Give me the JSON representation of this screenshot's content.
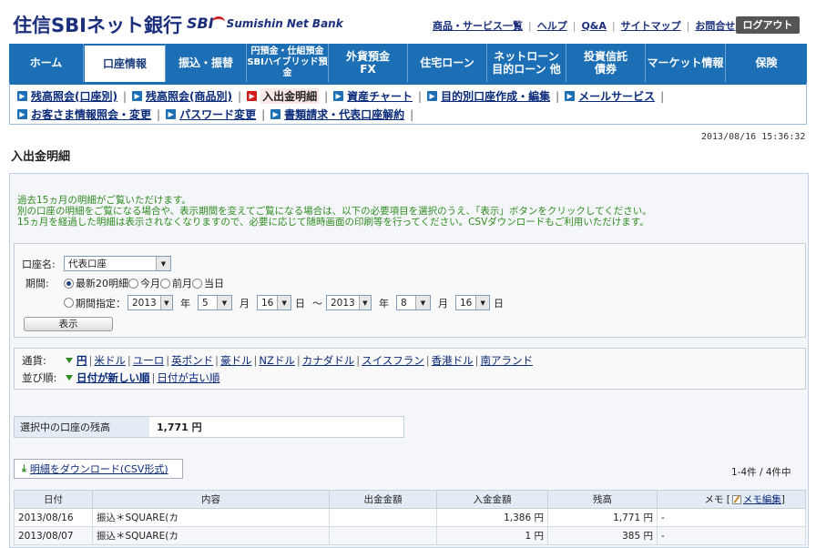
{
  "header": {
    "logo_jp": "住信SBIネット銀行",
    "logo_sbi": "SBI",
    "logo_sumishin": "Sumishin",
    "logo_netbank": "Net Bank",
    "top_links": [
      "商品・サービス一覧",
      "ヘルプ",
      "Q&A",
      "サイトマップ",
      "お問合せ"
    ],
    "logout_label": "ログアウト"
  },
  "nav": {
    "items": [
      {
        "label": "ホーム"
      },
      {
        "label": "口座情報"
      },
      {
        "label": "振込・振替"
      },
      {
        "label": "円預金・仕組預金\nSBIハイブリッド預金"
      },
      {
        "label": "外貨預金\nFX"
      },
      {
        "label": "住宅ローン"
      },
      {
        "label": "ネットローン\n目的ローン 他"
      },
      {
        "label": "投資信託\n債券"
      },
      {
        "label": "マーケット情報"
      },
      {
        "label": "保険"
      }
    ]
  },
  "subnav": {
    "row1": [
      "残高照会(口座別)",
      "残高照会(商品別)",
      "入出金明細",
      "資産チャート",
      "目的別口座作成・編集",
      "メールサービス"
    ],
    "row2": [
      "お客さま情報照会・変更",
      "パスワード変更",
      "書類請求・代表口座解約"
    ],
    "arrow": "▶"
  },
  "timestamp": "2013/08/16 15:36:32",
  "page_title": "入出金明細",
  "notice": {
    "line1": "過去15ヵ月の明細がご覧いただけます。",
    "line2": "別の口座の明細をご覧になる場合や、表示期間を変えてご覧になる場合は、以下の必要項目を選択のうえ、「表示」ボタンをクリックしてください。",
    "line3": "15ヵ月を経過した明細は表示されなくなりますので、必要に応じて随時画面の印刷等を行ってください。CSVダウンロードもご利用いただけます。"
  },
  "form": {
    "account_label": "口座名:",
    "account_value": "代表口座",
    "period_label": "期間:",
    "period_options": [
      "最新20明細",
      "今月",
      "前月",
      "当日"
    ],
    "period_specify": "期間指定：",
    "from_year": "2013",
    "from_month": "5",
    "from_day": "16",
    "to_year": "2013",
    "to_month": "8",
    "to_day": "16",
    "year_unit": "年",
    "month_unit": "月",
    "day_unit": "日",
    "tilde": "～",
    "show_button": "表示",
    "select_arrow": "▼"
  },
  "filter": {
    "currency_label": "通貨:",
    "currencies": [
      "円",
      "米ドル",
      "ユーロ",
      "英ポンド",
      "豪ドル",
      "NZドル",
      "カナダドル",
      "スイスフラン",
      "香港ドル",
      "南アランド"
    ],
    "sort_label": "並び順:",
    "sort_options": [
      "日付が新しい順",
      "日付が古い順"
    ]
  },
  "balance": {
    "label": "選択中の口座の残高",
    "value": "1,771 円"
  },
  "download": {
    "icon": "⤓",
    "label": "明細をダウンロード(CSV形式)"
  },
  "count": "1-4件 / 4件中",
  "table": {
    "headers": {
      "date": "日付",
      "content": "内容",
      "withdraw": "出金金額",
      "deposit": "入金金額",
      "balance": "残高",
      "memo": "メモ",
      "memo_edit": "メモ編集",
      "bracket_open": "[",
      "bracket_close": "]"
    },
    "rows": [
      {
        "date": "2013/08/16",
        "content": "振込＊SQUARE(カ",
        "withdraw": "",
        "deposit": "1,386 円",
        "balance": "1,771 円",
        "memo": "-"
      },
      {
        "date": "2013/08/07",
        "content": "振込＊SQUARE(カ",
        "withdraw": "",
        "deposit": "1 円",
        "balance": "385 円",
        "memo": "-"
      }
    ]
  }
}
